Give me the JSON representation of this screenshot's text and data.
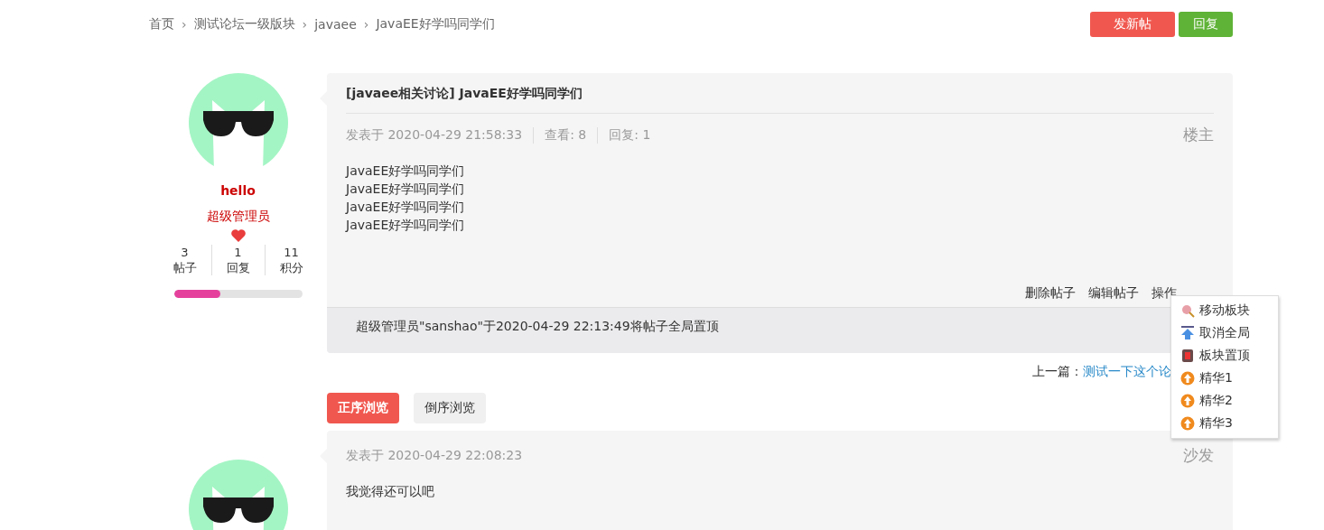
{
  "breadcrumb": [
    "首页",
    "测试论坛一级版块",
    "javaee",
    "JavaEE好学吗同学们"
  ],
  "separator": "›",
  "actions": [
    {
      "label": "发新帖",
      "kind": "new"
    },
    {
      "label": "回复",
      "kind": "reply"
    }
  ],
  "posts": [
    {
      "author": {
        "name": "hello",
        "role": "超级管理员",
        "stats": [
          {
            "value": "3",
            "label": "帖子"
          },
          {
            "value": "1",
            "label": "回复"
          },
          {
            "value": "11",
            "label": "积分"
          }
        ],
        "level": 0.36
      },
      "title": "[javaee相关讨论] JavaEE好学吗同学们",
      "meta": [
        "发表于 2020-04-29 21:58:33",
        "查看: 8",
        "回复: 1"
      ],
      "floor": "楼主",
      "body": [
        "JavaEE好学吗同学们",
        "JavaEE好学吗同学们",
        "JavaEE好学吗同学们",
        "JavaEE好学吗同学们"
      ],
      "tools": [
        "删除帖子",
        "编辑帖子",
        "操作"
      ],
      "notice": "超级管理员\"sanshao\"于2020-04-29 22:13:49将帖子全局置顶"
    },
    {
      "meta": [
        "发表于 2020-04-29 22:08:23"
      ],
      "floor": "沙发",
      "body": [
        "我觉得还可以吧"
      ]
    }
  ],
  "prev": {
    "label": "上一篇：",
    "link": "测试一下这个论"
  },
  "order_tabs": [
    {
      "label": "正序浏览",
      "selected": true
    },
    {
      "label": "倒序浏览",
      "selected": false
    }
  ],
  "menu": [
    {
      "label": "移动板块",
      "kind": "move"
    },
    {
      "label": "取消全局",
      "kind": "cancel"
    },
    {
      "label": "板块置顶",
      "kind": "pin"
    },
    {
      "label": "精华1",
      "kind": "digest"
    },
    {
      "label": "精华2",
      "kind": "digest"
    },
    {
      "label": "精华3",
      "kind": "digest"
    }
  ]
}
